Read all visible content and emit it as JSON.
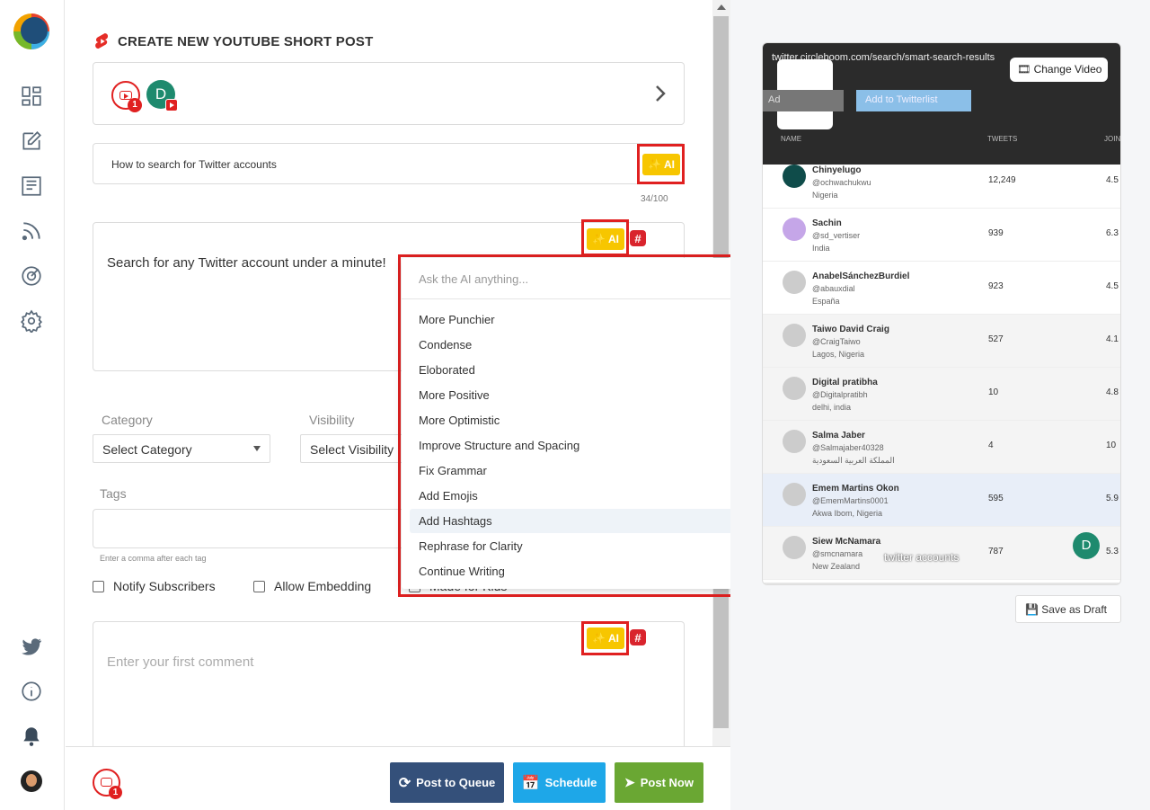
{
  "page": {
    "title": "CREATE NEW YOUTUBE SHORT POST"
  },
  "account": {
    "avatar_letter": "D",
    "badge_count": "1"
  },
  "title_field": {
    "value": "How to search for Twitter accounts",
    "counter": "34/100"
  },
  "ai_label": "AI",
  "description": {
    "value": "Search for any Twitter account under a minute!"
  },
  "ai_menu": {
    "placeholder": "Ask the AI anything...",
    "items": [
      "More Punchier",
      "Condense",
      "Eloborated",
      "More Positive",
      "More Optimistic",
      "Improve Structure and Spacing",
      "Fix Grammar",
      "Add Emojis",
      "Add Hashtags",
      "Rephrase for Clarity",
      "Continue Writing"
    ],
    "highlighted": "Add Hashtags"
  },
  "category": {
    "label": "Category",
    "value": "Select Category"
  },
  "visibility": {
    "label": "Visibility",
    "value": "Select Visibility"
  },
  "tags": {
    "label": "Tags",
    "hint": "Enter a comma after each tag"
  },
  "checkboxes": {
    "notify": "Notify Subscribers",
    "embed": "Allow Embedding",
    "kids": "Made for Kids"
  },
  "comment": {
    "placeholder": "Enter your first comment"
  },
  "actions": {
    "queue": "Post to Queue",
    "schedule": "Schedule",
    "post_now": "Post Now",
    "save_draft": "Save as Draft",
    "change_video": "Change Video"
  },
  "preview": {
    "url": "twitter.circleboom.com/search/smart-search-results",
    "add_list": "Add to Twitterlist",
    "add_short": "Ad",
    "columns": [
      "NAME",
      "TWEETS",
      "JOIN"
    ],
    "rows": [
      {
        "name": "Chinyelugo",
        "handle": "@ochwachukwu",
        "loc": "Nigeria",
        "tweets": "12,249",
        "join": "4.5"
      },
      {
        "name": "Sachin",
        "handle": "@sd_vertiser",
        "loc": "India",
        "tweets": "939",
        "join": "6.3"
      },
      {
        "name": "AnabelSánchezBurdiel",
        "handle": "@abauxdial",
        "loc": "España",
        "tweets": "923",
        "join": "4.5"
      },
      {
        "name": "Taiwo David Craig",
        "handle": "@CraigTaiwo",
        "loc": "Lagos, Nigeria",
        "tweets": "527",
        "join": "4.1"
      },
      {
        "name": "Digital pratibha",
        "handle": "@Digitalpratibh",
        "loc": "delhi, india",
        "tweets": "10",
        "join": "4.8"
      },
      {
        "name": "Salma Jaber",
        "handle": "@Salmajaber40328",
        "loc": "المملكة العربية السعودية",
        "tweets": "4",
        "join": "10"
      },
      {
        "name": "Emem Martins Okon",
        "handle": "@EmemMartins0001",
        "loc": "Akwa Ibom, Nigeria",
        "tweets": "595",
        "join": "5.9"
      },
      {
        "name": "Siew McNamara",
        "handle": "@smcnamara",
        "loc": "New Zealand",
        "tweets": "787",
        "join": "5.3"
      }
    ],
    "overlay_text": "twitter accounts",
    "avatar_letter": "D"
  },
  "colors": {
    "ai_yellow": "#f7c600",
    "highlight_red": "#e02020",
    "queue_btn": "#34507a",
    "schedule_btn": "#1ea7e8",
    "post_now_btn": "#6aa733"
  }
}
